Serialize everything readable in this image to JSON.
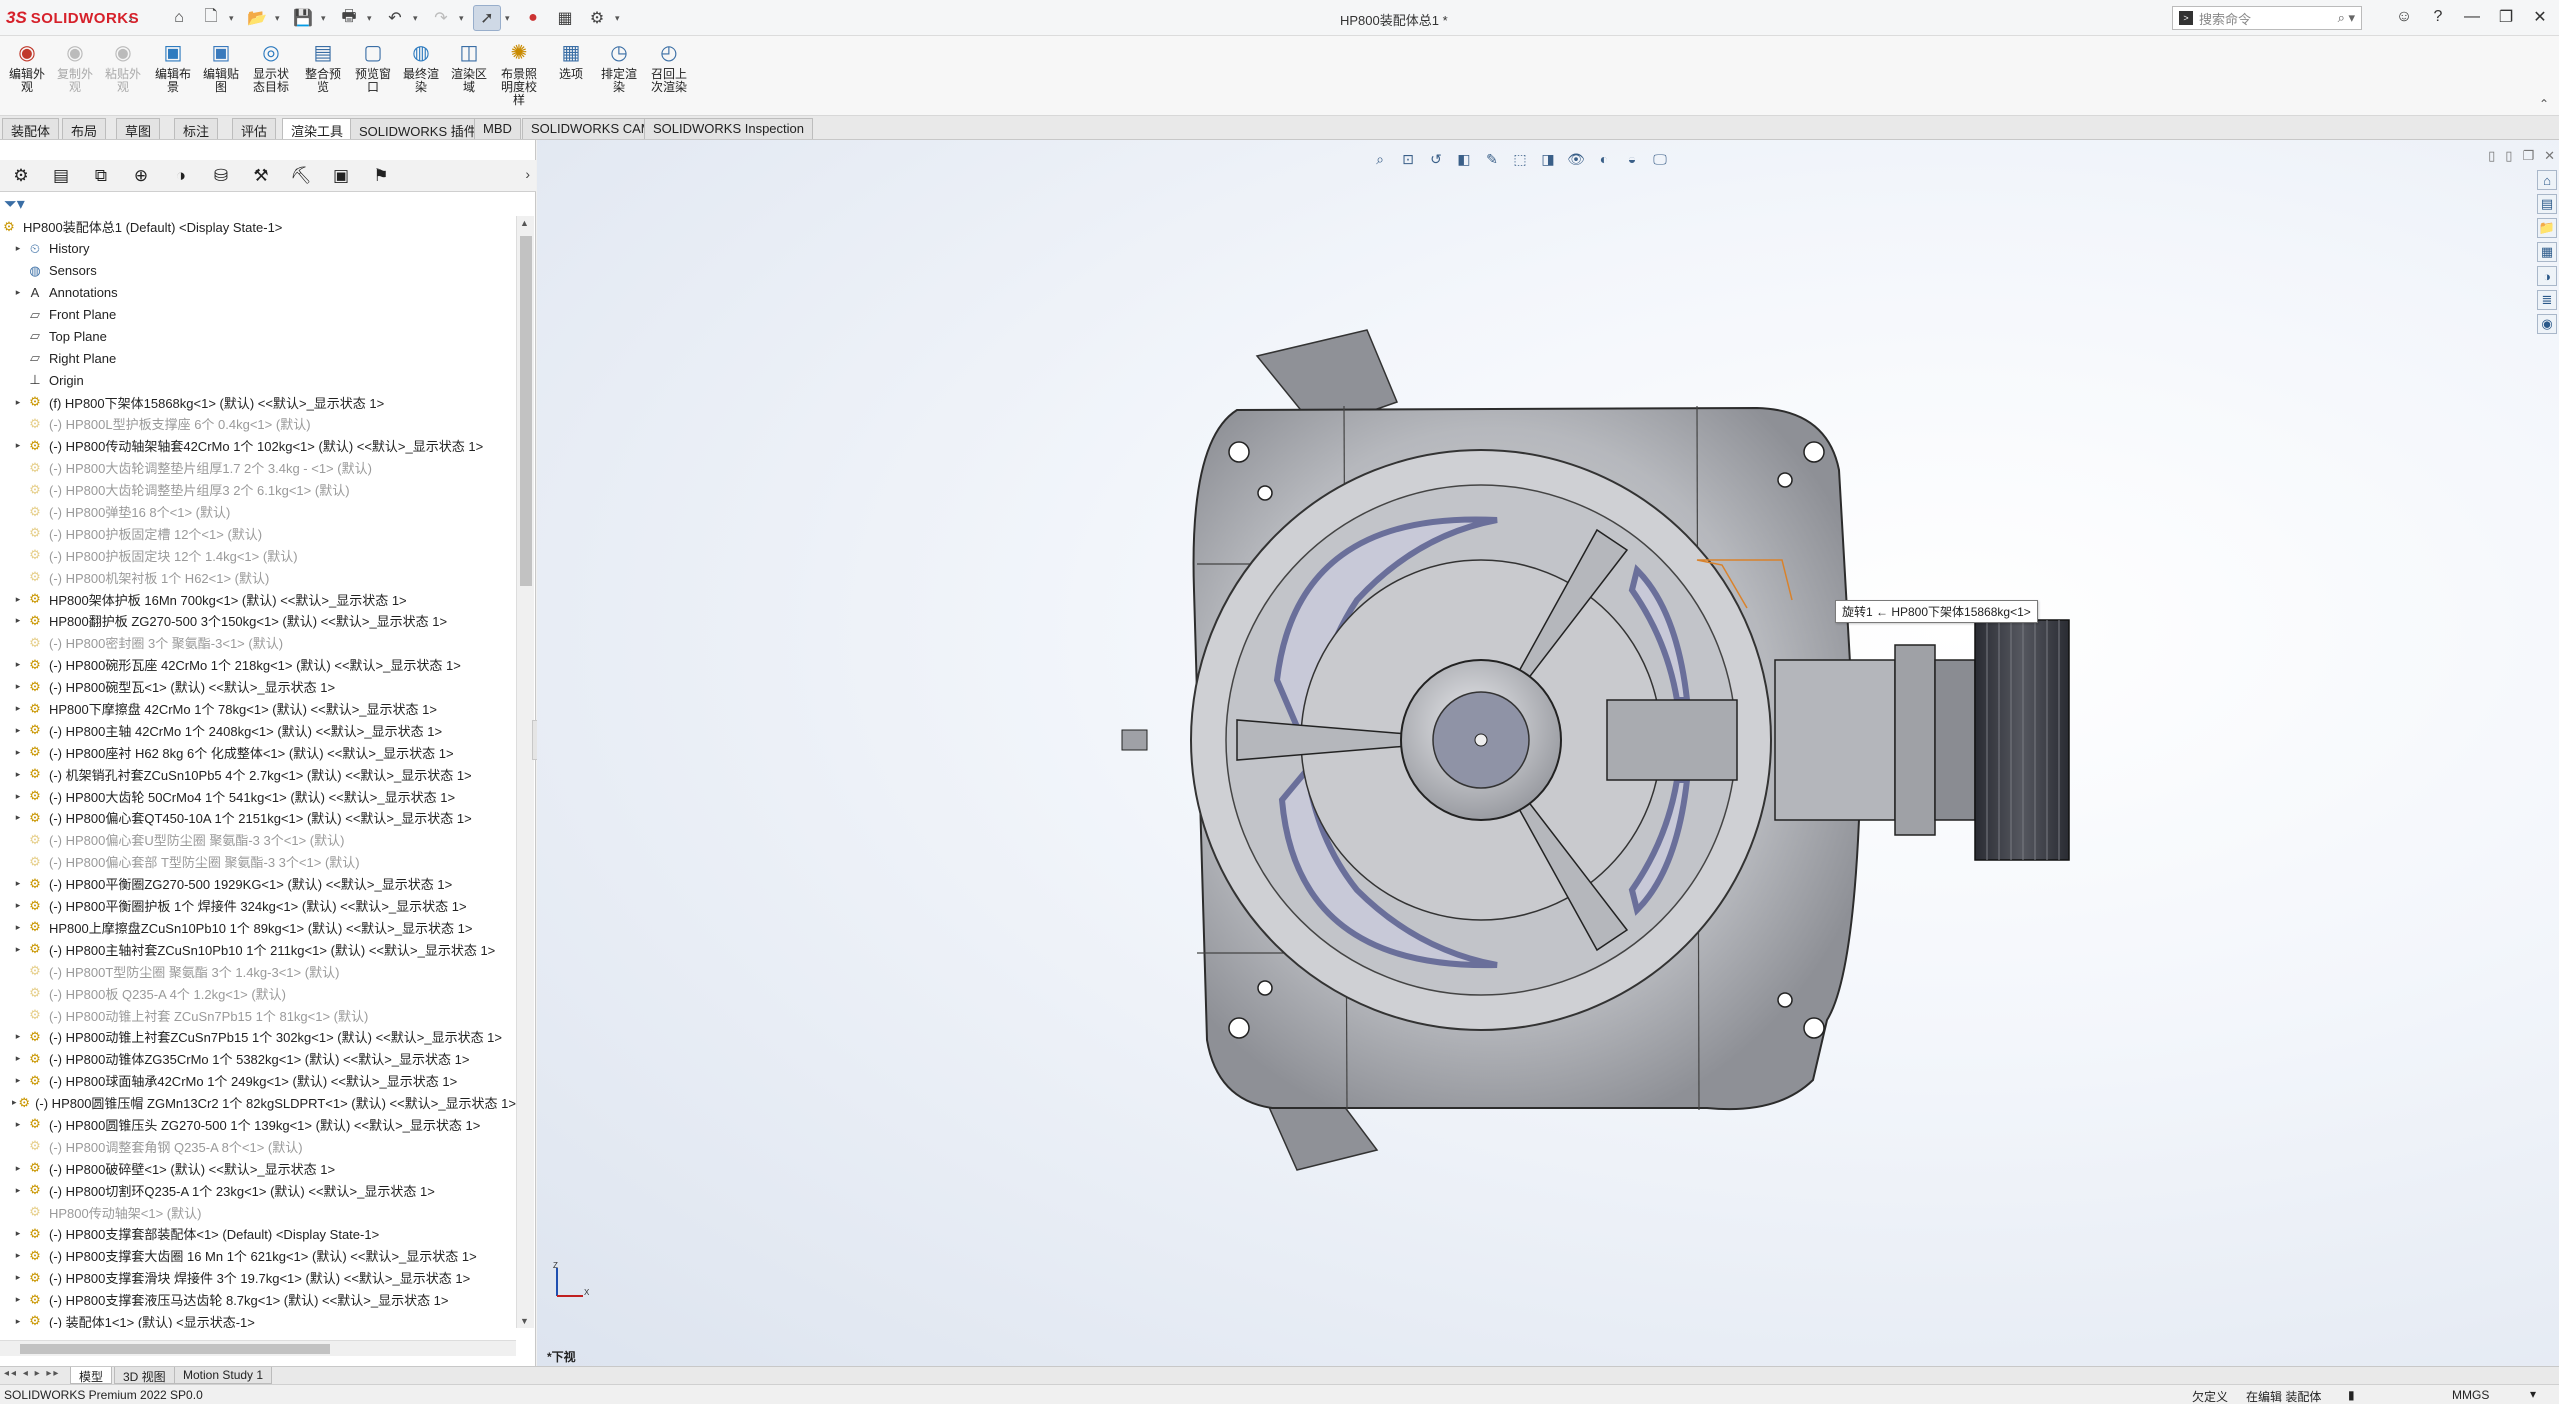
{
  "app": {
    "logo_ds": "3S",
    "logo_name": "SOLIDWORKS",
    "document_title": "HP800装配体总1 *",
    "search_placeholder": "搜索命令",
    "status_text": "SOLIDWORKS Premium 2022 SP0.0"
  },
  "ribbon": {
    "tools": [
      {
        "label": "编辑外\n观",
        "disabled": false,
        "icon": "appearance-icon"
      },
      {
        "label": "复制外\n观",
        "disabled": true,
        "icon": "copy-appearance-icon"
      },
      {
        "label": "粘贴外\n观",
        "disabled": true,
        "icon": "paste-appearance-icon"
      },
      {
        "label": "编辑布\n景",
        "disabled": false,
        "icon": "scene-icon"
      },
      {
        "label": "编辑贴\n图",
        "disabled": false,
        "icon": "decal-icon"
      },
      {
        "label": "显示状\n态目标",
        "disabled": false,
        "icon": "display-state-icon"
      },
      {
        "label": "整合预\n览",
        "disabled": false,
        "icon": "integrated-preview-icon"
      },
      {
        "label": "预览窗\n口",
        "disabled": false,
        "icon": "preview-window-icon"
      },
      {
        "label": "最终渲\n染",
        "disabled": false,
        "icon": "final-render-icon"
      },
      {
        "label": "渲染区\n域",
        "disabled": false,
        "icon": "render-region-icon"
      },
      {
        "label": "布景照\n明度校\n样",
        "disabled": false,
        "icon": "lighting-icon"
      },
      {
        "label": "选项",
        "disabled": false,
        "icon": "options-icon"
      },
      {
        "label": "排定渲\n染",
        "disabled": false,
        "icon": "schedule-render-icon"
      },
      {
        "label": "召回上\n次渲染",
        "disabled": false,
        "icon": "recall-render-icon"
      }
    ]
  },
  "cm_tabs": [
    {
      "label": "装配体",
      "active": false
    },
    {
      "label": "布局",
      "active": false
    },
    {
      "label": "草图",
      "active": false
    },
    {
      "label": "标注",
      "active": false
    },
    {
      "label": "评估",
      "active": false
    },
    {
      "label": "渲染工具",
      "active": true
    },
    {
      "label": "SOLIDWORKS 插件",
      "active": false
    },
    {
      "label": "MBD",
      "active": false
    },
    {
      "label": "SOLIDWORKS CAM",
      "active": false
    },
    {
      "label": "SOLIDWORKS Inspection",
      "active": false
    }
  ],
  "tree": {
    "root": "HP800装配体总1 (Default) <Display State-1>",
    "items": [
      {
        "text": "History",
        "kind": "folder",
        "exp": true,
        "sup": false
      },
      {
        "text": "Sensors",
        "kind": "sensor",
        "exp": false,
        "sup": false
      },
      {
        "text": "Annotations",
        "kind": "annotation",
        "exp": true,
        "sup": false
      },
      {
        "text": "Front Plane",
        "kind": "plane",
        "exp": false,
        "sup": false
      },
      {
        "text": "Top Plane",
        "kind": "plane",
        "exp": false,
        "sup": false
      },
      {
        "text": "Right Plane",
        "kind": "plane",
        "exp": false,
        "sup": false
      },
      {
        "text": "Origin",
        "kind": "origin",
        "exp": false,
        "sup": false
      },
      {
        "text": "(f) HP800下架体15868kg<1> (默认) <<默认>_显示状态 1>",
        "kind": "part",
        "exp": true,
        "sup": false
      },
      {
        "text": "(-) HP800L型护板支撑座 6个 0.4kg<1> (默认)",
        "kind": "part",
        "exp": false,
        "sup": true
      },
      {
        "text": "(-) HP800传动轴架轴套42CrMo 1个 102kg<1> (默认) <<默认>_显示状态 1>",
        "kind": "part",
        "exp": true,
        "sup": false
      },
      {
        "text": "(-) HP800大齿轮调整垫片组厚1.7 2个 3.4kg - <1> (默认)",
        "kind": "part",
        "exp": false,
        "sup": true
      },
      {
        "text": "(-) HP800大齿轮调整垫片组厚3 2个 6.1kg<1> (默认)",
        "kind": "part",
        "exp": false,
        "sup": true
      },
      {
        "text": "(-) HP800弹垫16 8个<1> (默认)",
        "kind": "part",
        "exp": false,
        "sup": true
      },
      {
        "text": "(-) HP800护板固定槽 12个<1> (默认)",
        "kind": "part",
        "exp": false,
        "sup": true
      },
      {
        "text": "(-) HP800护板固定块 12个 1.4kg<1> (默认)",
        "kind": "part",
        "exp": false,
        "sup": true
      },
      {
        "text": "(-) HP800机架衬板 1个 H62<1> (默认)",
        "kind": "part",
        "exp": false,
        "sup": true
      },
      {
        "text": "HP800架体护板 16Mn 700kg<1> (默认) <<默认>_显示状态 1>",
        "kind": "part",
        "exp": true,
        "sup": false
      },
      {
        "text": "HP800翻护板 ZG270-500 3个150kg<1> (默认) <<默认>_显示状态 1>",
        "kind": "part",
        "exp": true,
        "sup": false
      },
      {
        "text": "(-) HP800密封圈 3个 聚氨酯-3<1> (默认)",
        "kind": "part",
        "exp": false,
        "sup": true
      },
      {
        "text": "(-) HP800碗形瓦座 42CrMo 1个 218kg<1> (默认) <<默认>_显示状态 1>",
        "kind": "part",
        "exp": true,
        "sup": false
      },
      {
        "text": "(-) HP800碗型瓦<1> (默认) <<默认>_显示状态 1>",
        "kind": "part",
        "exp": true,
        "sup": false
      },
      {
        "text": "HP800下摩擦盘 42CrMo 1个 78kg<1> (默认) <<默认>_显示状态 1>",
        "kind": "part",
        "exp": true,
        "sup": false
      },
      {
        "text": "(-) HP800主轴 42CrMo 1个 2408kg<1> (默认) <<默认>_显示状态 1>",
        "kind": "part",
        "exp": true,
        "sup": false
      },
      {
        "text": "(-) HP800座衬 H62 8kg 6个 化成整体<1> (默认) <<默认>_显示状态 1>",
        "kind": "part",
        "exp": true,
        "sup": false
      },
      {
        "text": "(-) 机架销孔衬套ZCuSn10Pb5 4个 2.7kg<1> (默认) <<默认>_显示状态 1>",
        "kind": "part",
        "exp": true,
        "sup": false
      },
      {
        "text": "(-) HP800大齿轮 50CrMo4 1个 541kg<1> (默认) <<默认>_显示状态 1>",
        "kind": "part",
        "exp": true,
        "sup": false
      },
      {
        "text": "(-) HP800偏心套QT450-10A 1个 2151kg<1> (默认) <<默认>_显示状态 1>",
        "kind": "part",
        "exp": true,
        "sup": false
      },
      {
        "text": "(-) HP800偏心套U型防尘圈 聚氨酯-3 3个<1> (默认)",
        "kind": "part",
        "exp": false,
        "sup": true
      },
      {
        "text": "(-) HP800偏心套部 T型防尘圈 聚氨酯-3 3个<1> (默认)",
        "kind": "part",
        "exp": false,
        "sup": true
      },
      {
        "text": "(-) HP800平衡圈ZG270-500 1929KG<1> (默认) <<默认>_显示状态 1>",
        "kind": "part",
        "exp": true,
        "sup": false
      },
      {
        "text": "(-) HP800平衡圈护板 1个 焊接件 324kg<1> (默认) <<默认>_显示状态 1>",
        "kind": "part",
        "exp": true,
        "sup": false
      },
      {
        "text": "HP800上摩擦盘ZCuSn10Pb10 1个 89kg<1> (默认) <<默认>_显示状态 1>",
        "kind": "part",
        "exp": true,
        "sup": false
      },
      {
        "text": "(-) HP800主轴衬套ZCuSn10Pb10 1个 211kg<1> (默认) <<默认>_显示状态 1>",
        "kind": "part",
        "exp": true,
        "sup": false
      },
      {
        "text": "(-) HP800T型防尘圈 聚氨酯 3个 1.4kg-3<1> (默认)",
        "kind": "part",
        "exp": false,
        "sup": true
      },
      {
        "text": "(-) HP800板 Q235-A 4个 1.2kg<1> (默认)",
        "kind": "part",
        "exp": false,
        "sup": true
      },
      {
        "text": "(-) HP800动锥上衬套 ZCuSn7Pb15 1个 81kg<1> (默认)",
        "kind": "part",
        "exp": false,
        "sup": true
      },
      {
        "text": "(-) HP800动锥上衬套ZCuSn7Pb15 1个 302kg<1> (默认) <<默认>_显示状态 1>",
        "kind": "part",
        "exp": true,
        "sup": false
      },
      {
        "text": "(-) HP800动锥体ZG35CrMo 1个 5382kg<1> (默认) <<默认>_显示状态 1>",
        "kind": "part",
        "exp": true,
        "sup": false
      },
      {
        "text": "(-) HP800球面轴承42CrMo 1个 249kg<1> (默认) <<默认>_显示状态 1>",
        "kind": "part",
        "exp": true,
        "sup": false
      },
      {
        "text": "(-) HP800圆锥压帽 ZGMn13Cr2 1个 82kgSLDPRT<1> (默认) <<默认>_显示状态 1>",
        "kind": "part",
        "exp": true,
        "sup": false
      },
      {
        "text": "(-) HP800圆锥压头 ZG270-500 1个 139kg<1> (默认) <<默认>_显示状态 1>",
        "kind": "part",
        "exp": true,
        "sup": false
      },
      {
        "text": "(-) HP800调整套角钢 Q235-A 8个<1> (默认)",
        "kind": "part",
        "exp": false,
        "sup": true
      },
      {
        "text": "(-) HP800破碎壁<1> (默认) <<默认>_显示状态 1>",
        "kind": "part",
        "exp": true,
        "sup": false
      },
      {
        "text": "(-) HP800切割环Q235-A 1个 23kg<1> (默认) <<默认>_显示状态 1>",
        "kind": "part",
        "exp": true,
        "sup": false
      },
      {
        "text": "HP800传动轴架<1> (默认)",
        "kind": "part",
        "exp": false,
        "sup": true
      },
      {
        "text": "(-) HP800支撑套部装配体<1> (Default) <Display State-1>",
        "kind": "assembly",
        "exp": true,
        "sup": false
      },
      {
        "text": "(-) HP800支撑套大齿圈 16 Mn 1个 621kg<1> (默认) <<默认>_显示状态 1>",
        "kind": "part",
        "exp": true,
        "sup": false
      },
      {
        "text": "(-) HP800支撑套滑块 焊接件 3个 19.7kg<1> (默认) <<默认>_显示状态 1>",
        "kind": "part",
        "exp": true,
        "sup": false
      },
      {
        "text": "(-) HP800支撑套液压马达齿轮 8.7kg<1> (默认) <<默认>_显示状态 1>",
        "kind": "part",
        "exp": true,
        "sup": false
      },
      {
        "text": "(-) 装配体1<1> (默认) <显示状态-1>",
        "kind": "assembly",
        "exp": true,
        "sup": false
      }
    ]
  },
  "viewport": {
    "tooltip": "旋转1 ← HP800下架体15868kg<1>",
    "view_label": "*下视",
    "triad_z": "Z",
    "triad_x": "X"
  },
  "bottom_tabs": [
    {
      "label": "模型",
      "active": true
    },
    {
      "label": "3D 视图",
      "active": false
    },
    {
      "label": "Motion Study 1",
      "active": false
    }
  ],
  "status": {
    "s1": "欠定义",
    "s2": "在编辑 装配体",
    "s4": "MMGS",
    "s5": "▾"
  },
  "colors": {
    "brand_red": "#d6202a",
    "body_gray": "#b9bcc2",
    "accent_blue": "#6a6f9a"
  }
}
